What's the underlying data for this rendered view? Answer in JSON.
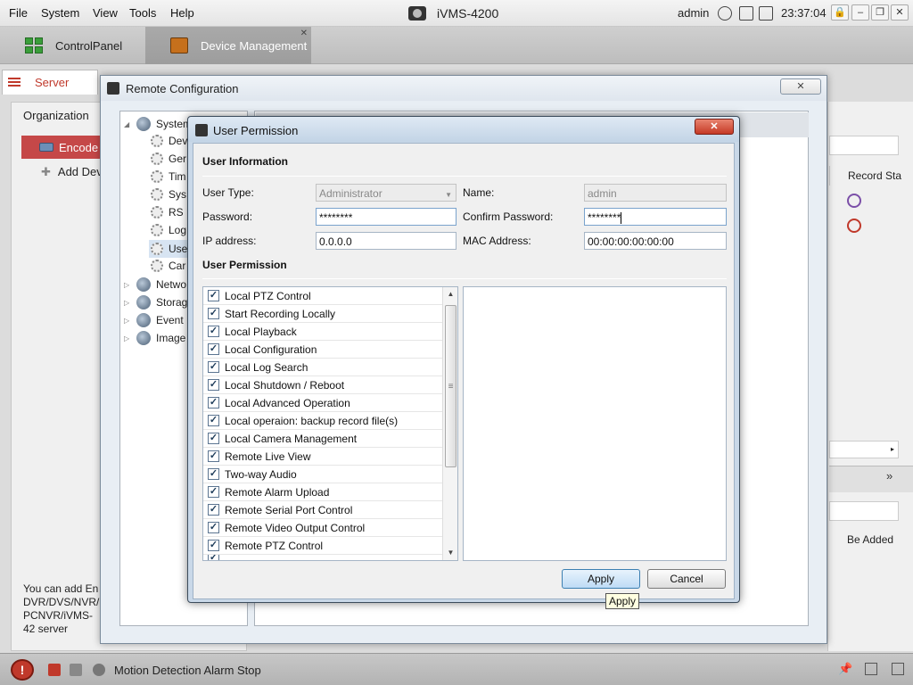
{
  "menubar": {
    "items": [
      "File",
      "System",
      "View",
      "Tools",
      "Help"
    ],
    "app_title": "iVMS-4200",
    "user": "admin",
    "clock": "23:37:04"
  },
  "tabs": [
    {
      "label": "ControlPanel"
    },
    {
      "label": "Device Management"
    }
  ],
  "background": {
    "server_tab": "Server",
    "organization": "Organization",
    "encoder": "Encode",
    "add_device": "Add Dev",
    "help_text": "You can add En DVR/DVS/NVR/I PCNVR/iVMS-42 server",
    "record_status_header": "Record Sta",
    "be_added": "Be Added",
    "colors": {
      "accent": "#c54848"
    }
  },
  "remote_config": {
    "title": "Remote Configuration",
    "close_label": "✕",
    "tree": [
      {
        "label": "System",
        "kind": "parent",
        "expanded": true
      },
      {
        "label": "Dev",
        "kind": "child"
      },
      {
        "label": "Ger",
        "kind": "child"
      },
      {
        "label": "Tim",
        "kind": "child"
      },
      {
        "label": "Sys",
        "kind": "child"
      },
      {
        "label": "RS",
        "kind": "child"
      },
      {
        "label": "Log",
        "kind": "child"
      },
      {
        "label": "Use",
        "kind": "child",
        "selected": true
      },
      {
        "label": "Car",
        "kind": "child"
      },
      {
        "label": "Netwo",
        "kind": "parent",
        "expanded": false
      },
      {
        "label": "Storag",
        "kind": "parent",
        "expanded": false
      },
      {
        "label": "Event",
        "kind": "parent",
        "expanded": false
      },
      {
        "label": "Image",
        "kind": "parent",
        "expanded": false
      }
    ]
  },
  "user_permission": {
    "title": "User Permission",
    "close_label": "✕",
    "user_info_header": "User Information",
    "user_type_label": "User Type:",
    "user_type_value": "Administrator",
    "name_label": "Name:",
    "name_value": "admin",
    "password_label": "Password:",
    "password_value": "********",
    "confirm_label": "Confirm Password:",
    "confirm_value": "********",
    "ip_label": "IP address:",
    "ip_value": "0.0.0.0",
    "mac_label": "MAC Address:",
    "mac_value": "00:00:00:00:00:00",
    "permission_header": "User Permission",
    "permissions": [
      "Local PTZ Control",
      "Start Recording Locally",
      "Local Playback",
      "Local Configuration",
      "Local Log Search",
      "Local Shutdown / Reboot",
      "Local Advanced Operation",
      "Local operaion: backup record file(s)",
      "Local Camera Management",
      "Remote Live View",
      "Two-way Audio",
      "Remote Alarm Upload",
      "Remote Serial Port Control",
      "Remote Video Output Control",
      "Remote PTZ Control"
    ],
    "apply_label": "Apply",
    "cancel_label": "Cancel",
    "tooltip": "Apply"
  },
  "statusbar": {
    "message": "Motion Detection Alarm Stop"
  }
}
